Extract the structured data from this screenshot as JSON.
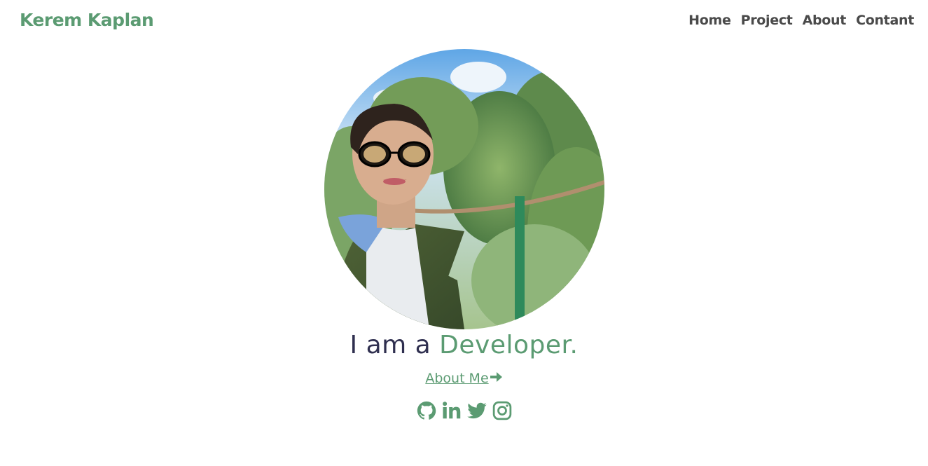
{
  "header": {
    "brand": "Kerem Kaplan",
    "nav": [
      "Home",
      "Project",
      "About",
      "Contant"
    ]
  },
  "hero": {
    "headline_prefix": "I am a ",
    "headline_accent": "Developer.",
    "about_link": "About Me"
  },
  "socials": [
    "github-icon",
    "linkedin-icon",
    "twitter-icon",
    "instagram-icon"
  ],
  "colors": {
    "accent": "#5b9b72",
    "nav_text": "#4a4a4a",
    "headline_text": "#2f2f4f",
    "background": "#ffffff"
  }
}
